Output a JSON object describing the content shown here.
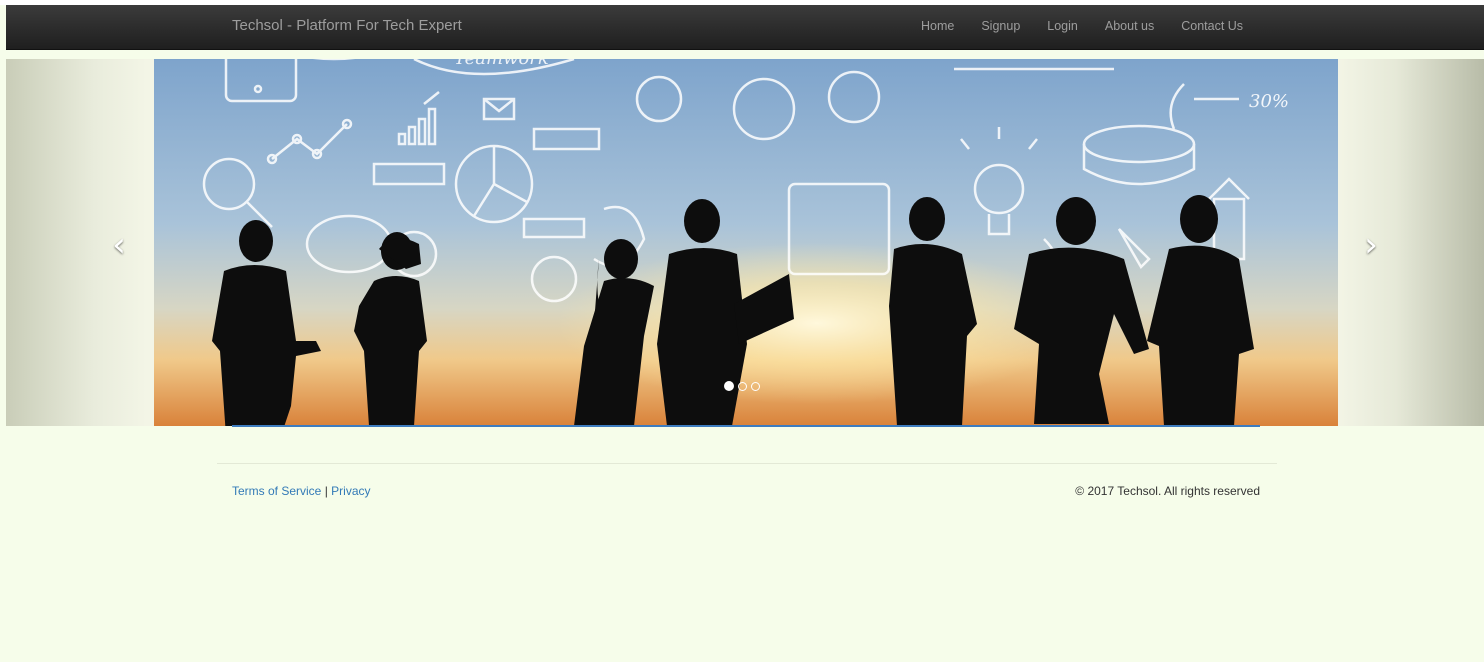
{
  "navbar": {
    "brand": "Techsol - Platform For Tech Expert",
    "items": [
      {
        "label": "Home"
      },
      {
        "label": "Signup"
      },
      {
        "label": "Login"
      },
      {
        "label": "About us"
      },
      {
        "label": "Contact Us"
      }
    ]
  },
  "carousel": {
    "prev_icon": "chevron-left-icon",
    "next_icon": "chevron-right-icon",
    "prev_glyph": "‹",
    "next_glyph": "›",
    "slide_count": 3,
    "active_index": 0,
    "slide_text": {
      "doodle_word": "Teamwork",
      "percent": "30%"
    }
  },
  "footer": {
    "terms": "Terms of Service",
    "separator": " | ",
    "privacy": "Privacy",
    "copyright": "© 2017 Techsol. All rights reserved"
  },
  "colors": {
    "page_bg": "#f6fdea",
    "navbar_bg": "#222222",
    "nav_text": "#9d9d9d",
    "link": "#337ab7",
    "accent_line": "#3d7cbf"
  }
}
